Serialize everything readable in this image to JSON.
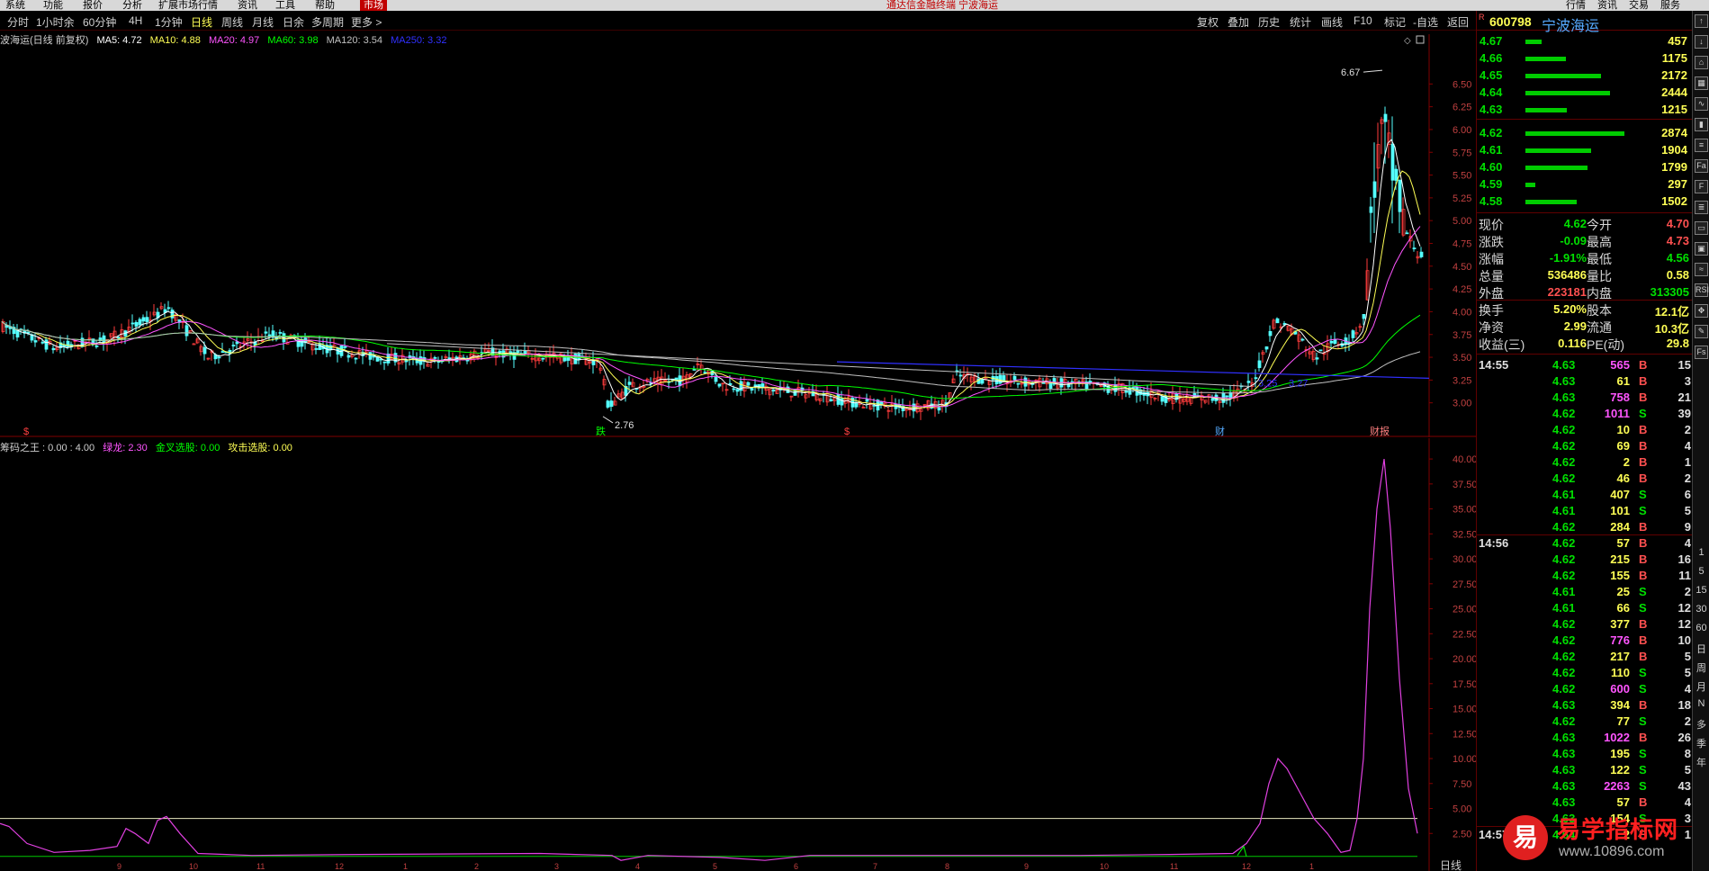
{
  "menubar": {
    "items": [
      "系统",
      "功能",
      "报价",
      "分析",
      "扩展市场行情",
      "资讯",
      "工具",
      "帮助"
    ],
    "active_tab": "市场",
    "window_title": "通达信金融终端 宁波海运",
    "right_items": [
      "行情",
      "资讯",
      "交易",
      "服务"
    ]
  },
  "toolbar": {
    "periods": [
      "分时",
      "1小时余",
      "60分钟",
      "4H",
      "1分钟",
      "日线",
      "周线",
      "月线",
      "日余",
      "多周期",
      "更多 >"
    ],
    "selected": "日线",
    "right_items": [
      "复权",
      "叠加",
      "历史",
      "统计",
      "画线",
      "F10",
      "标记",
      "-自选",
      "返回"
    ]
  },
  "ma_line": {
    "name": "波海运(日线 前复权)",
    "ma5": "MA5: 4.72",
    "ma10": "MA10: 4.88",
    "ma20": "MA20: 4.97",
    "ma60": "MA60: 3.98",
    "ma120": "MA120: 3.54",
    "ma250": "MA250: 3.32",
    "colors": {
      "ma5": "#ffffff",
      "ma10": "#ffff55",
      "ma20": "#ff55ff",
      "ma60": "#00ff00",
      "ma120": "#c0c0c0",
      "ma250": "#3030ff"
    }
  },
  "sub_line": {
    "name": "筹码之王 : 0.00 : 4.00",
    "lvlong": "绿龙: 2.30",
    "jincha": "金叉选股: 0.00",
    "gongji": "攻击选股: 0.00"
  },
  "main_axis": [
    "6.50",
    "6.25",
    "6.00",
    "5.75",
    "5.50",
    "5.25",
    "5.00",
    "4.75",
    "4.50",
    "4.25",
    "4.00",
    "3.75",
    "3.50",
    "3.25",
    "3.00"
  ],
  "sub_axis": [
    "40.00",
    "37.50",
    "35.00",
    "32.50",
    "30.00",
    "27.50",
    "25.00",
    "22.50",
    "20.00",
    "17.50",
    "15.00",
    "12.50",
    "10.00",
    "7.50",
    "5.00",
    "2.50"
  ],
  "chart_annotations": {
    "high": "6.67",
    "low": "2.76",
    "line1": "3.25",
    "line2": "3.27"
  },
  "chart_markers": [
    "$",
    "跌",
    "$",
    "财",
    "财报"
  ],
  "x_months": [
    "9",
    "10",
    "11",
    "12",
    "1",
    "2",
    "3",
    "4",
    "5",
    "6",
    "7",
    "8",
    "9",
    "10",
    "11",
    "12",
    "1"
  ],
  "bottom_label": "日线",
  "stock": {
    "flag": "R",
    "code": "600798",
    "name": "宁波海运"
  },
  "order_book": {
    "asks": [
      {
        "price": "4.67",
        "vol": "457",
        "bar": 0.16
      },
      {
        "price": "4.66",
        "vol": "1175",
        "bar": 0.41
      },
      {
        "price": "4.65",
        "vol": "2172",
        "bar": 0.76
      },
      {
        "price": "4.64",
        "vol": "2444",
        "bar": 0.85
      },
      {
        "price": "4.63",
        "vol": "1215",
        "bar": 0.42
      }
    ],
    "bids": [
      {
        "price": "4.62",
        "vol": "2874",
        "bar": 1.0
      },
      {
        "price": "4.61",
        "vol": "1904",
        "bar": 0.66
      },
      {
        "price": "4.60",
        "vol": "1799",
        "bar": 0.63
      },
      {
        "price": "4.59",
        "vol": "297",
        "bar": 0.1
      },
      {
        "price": "4.58",
        "vol": "1502",
        "bar": 0.52
      }
    ]
  },
  "quote": [
    {
      "l": "现价",
      "lv": "4.62",
      "lc": "#00e000",
      "r": "今开",
      "rv": "4.70",
      "rc": "#ff5050"
    },
    {
      "l": "涨跌",
      "lv": "-0.09",
      "lc": "#00e000",
      "r": "最高",
      "rv": "4.73",
      "rc": "#ff5050"
    },
    {
      "l": "涨幅",
      "lv": "-1.91%",
      "lc": "#00e000",
      "r": "最低",
      "rv": "4.56",
      "rc": "#00e000"
    },
    {
      "l": "总量",
      "lv": "536486",
      "lc": "#ffff55",
      "r": "量比",
      "rv": "0.58",
      "rc": "#ffff55"
    },
    {
      "l": "外盘",
      "lv": "223181",
      "lc": "#ff5050",
      "r": "内盘",
      "rv": "313305",
      "rc": "#00e000"
    },
    {
      "l": "换手",
      "lv": "5.20%",
      "lc": "#ffff55",
      "r": "股本",
      "rv": "12.1亿",
      "rc": "#ffff55"
    },
    {
      "l": "净资",
      "lv": "2.99",
      "lc": "#ffff55",
      "r": "流通",
      "rv": "10.3亿",
      "rc": "#ffff55"
    },
    {
      "l": "收益(三)",
      "lv": "0.116",
      "lc": "#ffff55",
      "r": "PE(动)",
      "rv": "29.8",
      "rc": "#ffff55"
    }
  ],
  "ticks": [
    {
      "t": "14:55",
      "p": "4.63",
      "v": "565",
      "d": "B",
      "n": "15"
    },
    {
      "t": "",
      "p": "4.63",
      "v": "61",
      "d": "B",
      "n": "3"
    },
    {
      "t": "",
      "p": "4.63",
      "v": "758",
      "d": "B",
      "n": "21"
    },
    {
      "t": "",
      "p": "4.62",
      "v": "1011",
      "d": "S",
      "n": "39"
    },
    {
      "t": "",
      "p": "4.62",
      "v": "10",
      "d": "B",
      "n": "2"
    },
    {
      "t": "",
      "p": "4.62",
      "v": "69",
      "d": "B",
      "n": "4"
    },
    {
      "t": "",
      "p": "4.62",
      "v": "2",
      "d": "B",
      "n": "1"
    },
    {
      "t": "",
      "p": "4.62",
      "v": "46",
      "d": "B",
      "n": "2"
    },
    {
      "t": "",
      "p": "4.61",
      "v": "407",
      "d": "S",
      "n": "6"
    },
    {
      "t": "",
      "p": "4.61",
      "v": "101",
      "d": "S",
      "n": "5"
    },
    {
      "t": "",
      "p": "4.62",
      "v": "284",
      "d": "B",
      "n": "9"
    },
    {
      "t": "14:56",
      "p": "4.62",
      "v": "57",
      "d": "B",
      "n": "4"
    },
    {
      "t": "",
      "p": "4.62",
      "v": "215",
      "d": "B",
      "n": "16"
    },
    {
      "t": "",
      "p": "4.62",
      "v": "155",
      "d": "B",
      "n": "11"
    },
    {
      "t": "",
      "p": "4.61",
      "v": "25",
      "d": "S",
      "n": "2"
    },
    {
      "t": "",
      "p": "4.61",
      "v": "66",
      "d": "S",
      "n": "12"
    },
    {
      "t": "",
      "p": "4.62",
      "v": "377",
      "d": "B",
      "n": "12"
    },
    {
      "t": "",
      "p": "4.62",
      "v": "776",
      "d": "B",
      "n": "10"
    },
    {
      "t": "",
      "p": "4.62",
      "v": "217",
      "d": "B",
      "n": "5"
    },
    {
      "t": "",
      "p": "4.62",
      "v": "110",
      "d": "S",
      "n": "5"
    },
    {
      "t": "",
      "p": "4.62",
      "v": "600",
      "d": "S",
      "n": "4"
    },
    {
      "t": "",
      "p": "4.63",
      "v": "394",
      "d": "B",
      "n": "18"
    },
    {
      "t": "",
      "p": "4.62",
      "v": "77",
      "d": "S",
      "n": "2"
    },
    {
      "t": "",
      "p": "4.63",
      "v": "1022",
      "d": "B",
      "n": "26"
    },
    {
      "t": "",
      "p": "4.63",
      "v": "195",
      "d": "S",
      "n": "8"
    },
    {
      "t": "",
      "p": "4.63",
      "v": "122",
      "d": "S",
      "n": "5"
    },
    {
      "t": "",
      "p": "4.63",
      "v": "2263",
      "d": "S",
      "n": "43"
    },
    {
      "t": "",
      "p": "4.63",
      "v": "57",
      "d": "B",
      "n": "4"
    },
    {
      "t": "",
      "p": "4.63",
      "v": "154",
      "d": "S",
      "n": "3"
    },
    {
      "t": "14:57",
      "p": "4.64",
      "v": "2",
      "d": "B",
      "n": "1"
    }
  ],
  "icon_strip": [
    "↑",
    "↓",
    "⌂",
    "▦",
    "∿",
    "▮",
    "≡",
    "Fa",
    "F",
    "≣",
    "▭",
    "▣",
    "≈",
    "RSI",
    "✥",
    "✎",
    "Fs",
    "1",
    "5",
    "15",
    "30",
    "60",
    "日",
    "周",
    "月",
    "N",
    "多",
    "季",
    "年"
  ],
  "watermark": {
    "logo": "易",
    "title": "易学指标网",
    "url": "www.10896.com"
  }
}
